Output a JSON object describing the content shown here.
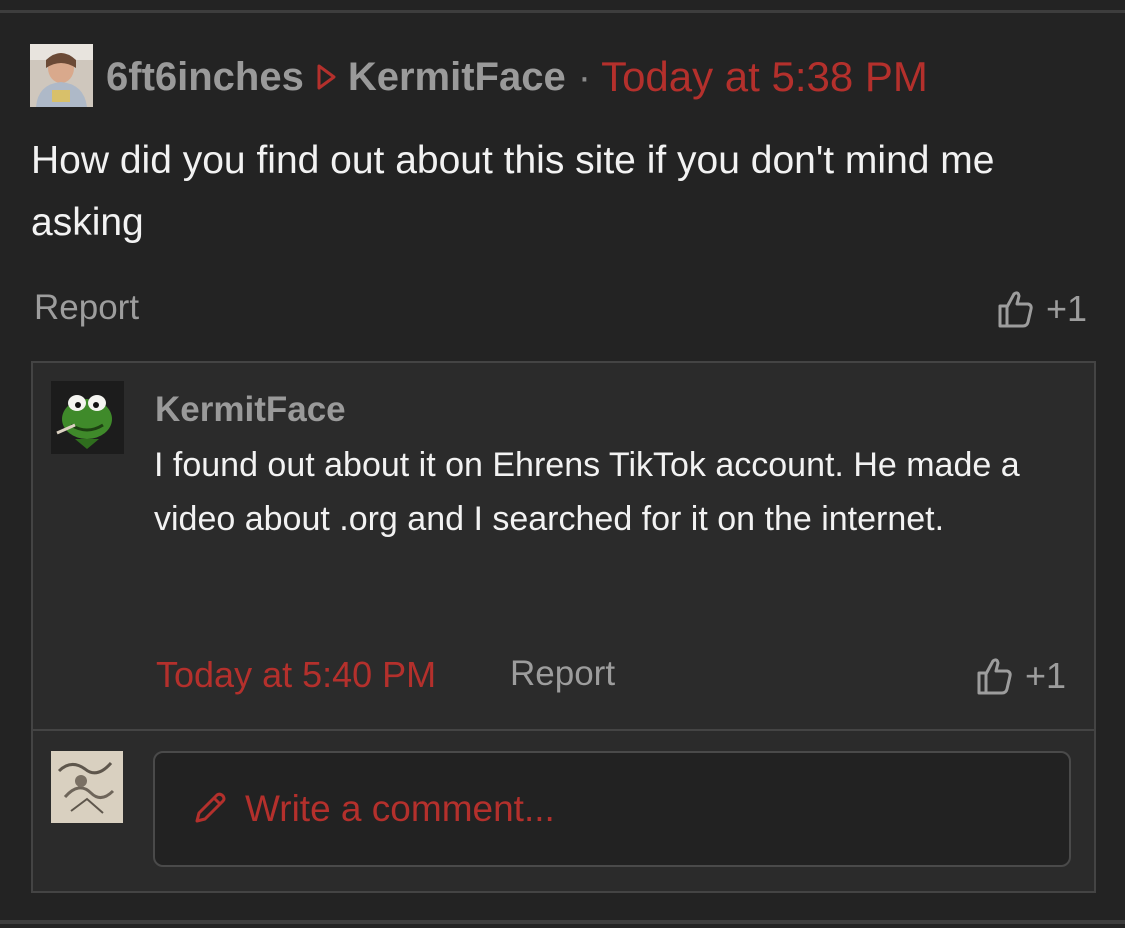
{
  "post": {
    "author": "6ft6inches",
    "reply_to": "KermitFace",
    "separator": "·",
    "timestamp": "Today at 5:38 PM",
    "body": "How did you find out about this site if you don't mind me asking",
    "report_label": "Report",
    "like_count": "+1"
  },
  "reply": {
    "author": "KermitFace",
    "body": "I found out about it on Ehrens TikTok account. He made a video about .org and I searched for it on the internet.",
    "timestamp": "Today at 5:40 PM",
    "report_label": "Report",
    "like_count": "+1"
  },
  "composer": {
    "placeholder": "Write a comment..."
  },
  "colors": {
    "background": "#232323",
    "panel": "#2b2b2b",
    "accent": "#b4302c",
    "muted_text": "#9d9d9d",
    "body_text": "#f2f2f2"
  },
  "icons": {
    "reply_arrow": "reply-arrow-icon",
    "like": "thumbs-up-icon",
    "pencil": "pencil-icon"
  }
}
